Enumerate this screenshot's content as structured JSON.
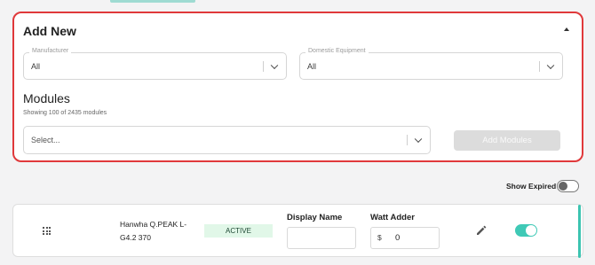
{
  "panel": {
    "title": "Add New",
    "manufacturer": {
      "label": "Manufacturer",
      "value": "All"
    },
    "domestic_equipment": {
      "label": "Domestic Equipment",
      "value": "All"
    },
    "modules_heading": "Modules",
    "modules_count": "Showing 100 of 2435 modules",
    "modules_select": {
      "placeholder": "Select..."
    },
    "add_modules_label": "Add Modules"
  },
  "filters": {
    "show_expired_label": "Show Expired",
    "show_expired_on": false
  },
  "module_row": {
    "name": "Hanwha Q.PEAK L-G4.2 370",
    "status": "ACTIVE",
    "display_name_label": "Display Name",
    "display_name_value": "",
    "watt_adder_label": "Watt Adder",
    "currency_symbol": "$",
    "watt_adder_value": "0",
    "enabled": true
  },
  "colors": {
    "highlight_border": "#e0393b",
    "accent": "#3fc9b6",
    "active_badge_bg": "#e1f7e8",
    "disabled_button": "#dcdcdc"
  },
  "icons": [
    "chevron-up-icon",
    "chevron-down-icon",
    "drag-handle-icon",
    "pencil-icon",
    "toggle-icon"
  ]
}
